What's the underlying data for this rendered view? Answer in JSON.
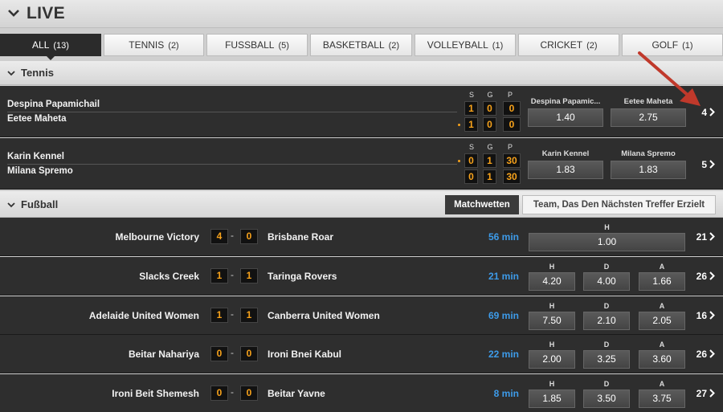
{
  "header": {
    "title": "LIVE"
  },
  "tabs": [
    {
      "label": "ALL",
      "count": "(13)"
    },
    {
      "label": "TENNIS",
      "count": "(2)"
    },
    {
      "label": "FUSSBALL",
      "count": "(5)"
    },
    {
      "label": "BASKETBALL",
      "count": "(2)"
    },
    {
      "label": "VOLLEYBALL",
      "count": "(1)"
    },
    {
      "label": "CRICKET",
      "count": "(2)"
    },
    {
      "label": "GOLF",
      "count": "(1)"
    }
  ],
  "tennis": {
    "title": "Tennis",
    "score_headers": [
      "S",
      "G",
      "P"
    ],
    "matches": [
      {
        "p1": "Despina Papamichail",
        "p2": "Eetee Maheta",
        "s1": [
          "1",
          "0",
          "0"
        ],
        "s2": [
          "1",
          "0",
          "0"
        ],
        "odds": [
          {
            "label": "Despina Papamic...",
            "value": "1.40"
          },
          {
            "label": "Eetee Maheta",
            "value": "2.75"
          }
        ],
        "more": "4"
      },
      {
        "p1": "Karin Kennel",
        "p2": "Milana Spremo",
        "s1": [
          "0",
          "1",
          "30"
        ],
        "s2": [
          "0",
          "1",
          "30"
        ],
        "odds": [
          {
            "label": "Karin Kennel",
            "value": "1.83"
          },
          {
            "label": "Milana Spremo",
            "value": "1.83"
          }
        ],
        "more": "5"
      }
    ]
  },
  "football": {
    "title": "Fußball",
    "markets": [
      "Matchwetten",
      "Team, Das Den Nächsten Treffer Erzielt"
    ],
    "matches": [
      {
        "home": "Melbourne Victory",
        "away": "Brisbane Roar",
        "hs": "4",
        "as": "0",
        "time": "56 min",
        "odds": [
          {
            "label": "H",
            "value": "1.00"
          }
        ],
        "more": "21"
      },
      {
        "home": "Slacks Creek",
        "away": "Taringa Rovers",
        "hs": "1",
        "as": "1",
        "time": "21 min",
        "odds": [
          {
            "label": "H",
            "value": "4.20"
          },
          {
            "label": "D",
            "value": "4.00"
          },
          {
            "label": "A",
            "value": "1.66"
          }
        ],
        "more": "26"
      },
      {
        "home": "Adelaide United Women",
        "away": "Canberra United Women",
        "hs": "1",
        "as": "1",
        "time": "69 min",
        "odds": [
          {
            "label": "H",
            "value": "7.50"
          },
          {
            "label": "D",
            "value": "2.10"
          },
          {
            "label": "A",
            "value": "2.05"
          }
        ],
        "more": "16"
      },
      {
        "home": "Beitar Nahariya",
        "away": "Ironi Bnei Kabul",
        "hs": "0",
        "as": "0",
        "time": "22 min",
        "odds": [
          {
            "label": "H",
            "value": "2.00"
          },
          {
            "label": "D",
            "value": "3.25"
          },
          {
            "label": "A",
            "value": "3.60"
          }
        ],
        "more": "26"
      },
      {
        "home": "Ironi Beit Shemesh",
        "away": "Beitar Yavne",
        "hs": "0",
        "as": "0",
        "time": "8 min",
        "odds": [
          {
            "label": "H",
            "value": "1.85"
          },
          {
            "label": "D",
            "value": "3.50"
          },
          {
            "label": "A",
            "value": "3.75"
          }
        ],
        "more": "27"
      }
    ]
  },
  "colors": {
    "accent": "#f7a21b",
    "time": "#3d9be9",
    "row_bg": "#2e2e2e",
    "annotation_arrow": "#c0392b"
  }
}
